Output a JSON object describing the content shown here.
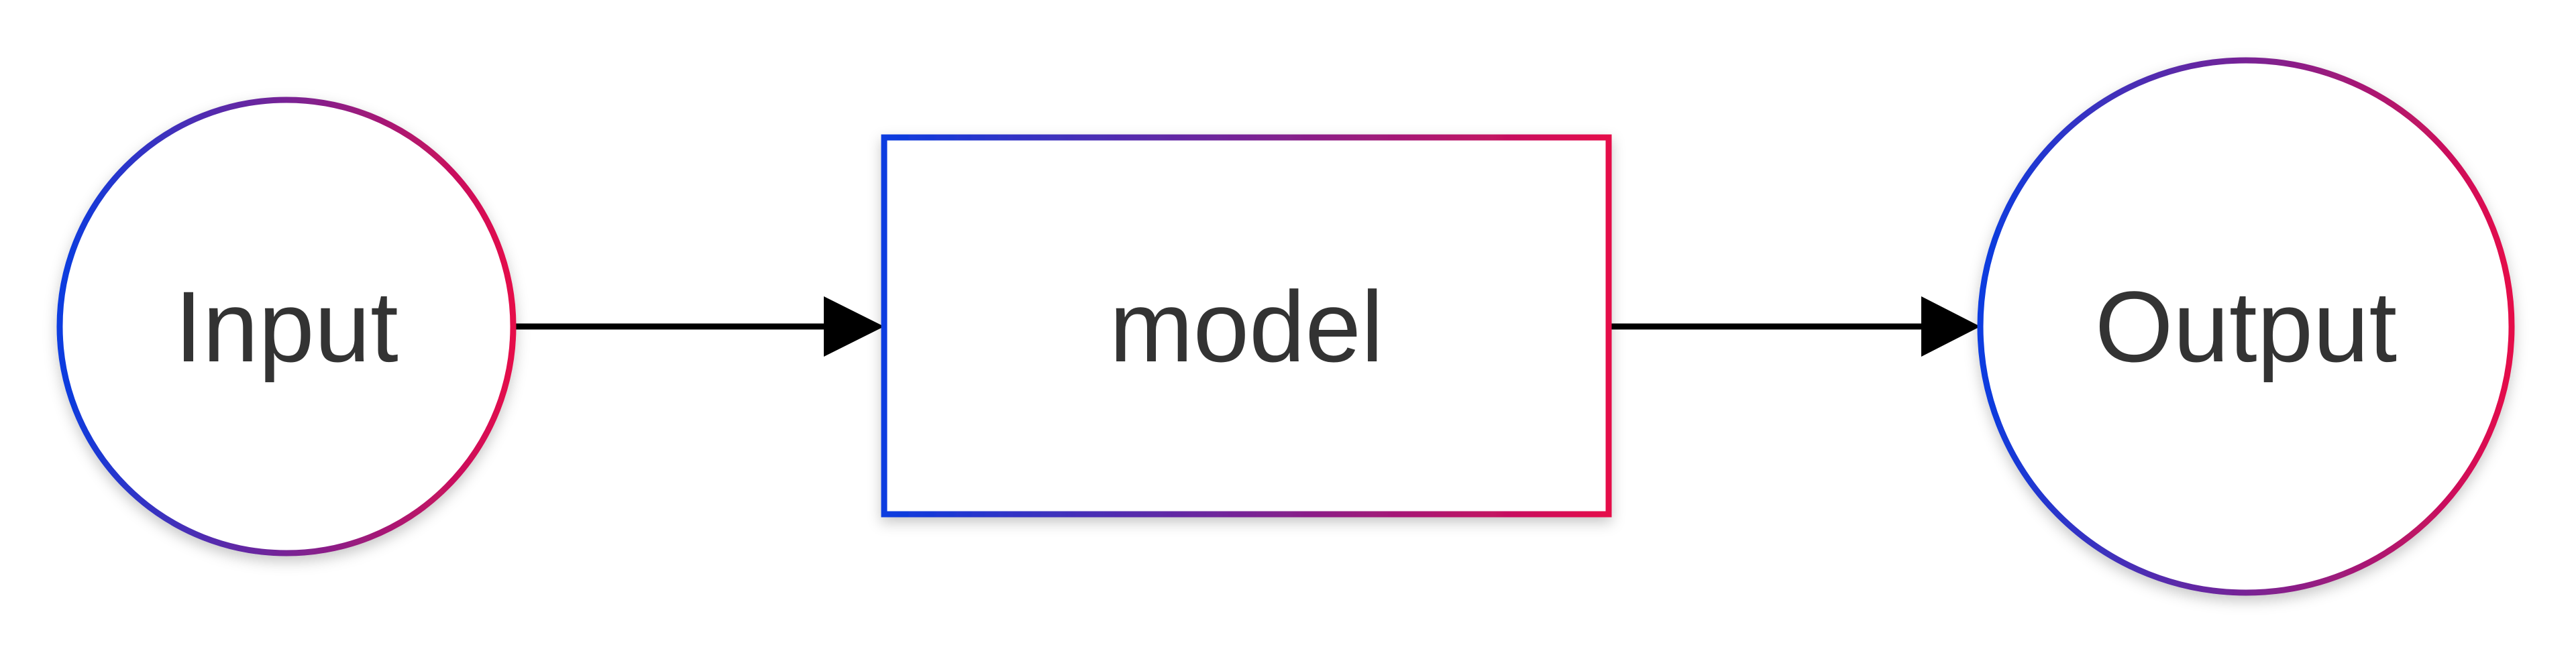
{
  "nodes": {
    "input": {
      "label": "Input"
    },
    "model": {
      "label": "model"
    },
    "output": {
      "label": "Output"
    }
  },
  "edges": [
    {
      "from": "Input",
      "to": "model"
    },
    {
      "from": "model",
      "to": "Output"
    }
  ],
  "colors": {
    "stroke_gradient_start": "#0a3ce0",
    "stroke_gradient_end": "#e50a4a",
    "edge": "#000000",
    "label": "#333333",
    "background": "#ffffff"
  }
}
